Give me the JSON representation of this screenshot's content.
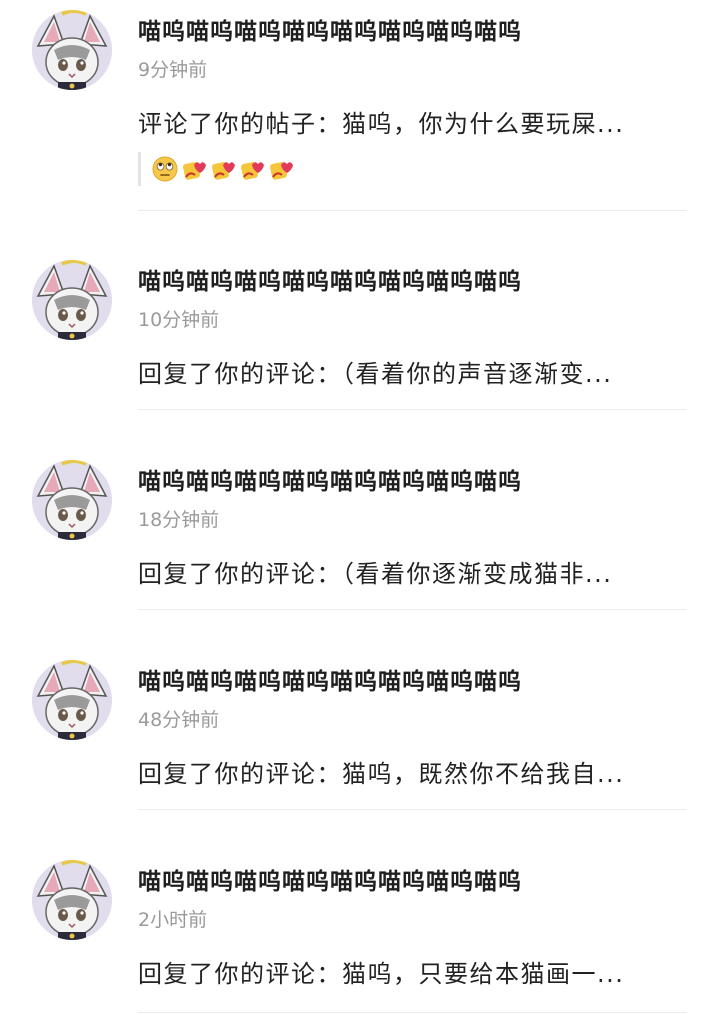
{
  "notifications": [
    {
      "username": "喵呜喵呜喵呜喵呜喵呜喵呜喵呜喵呜",
      "time": "9分钟前",
      "content": "评论了你的帖子：猫呜，你为什么要玩屎...",
      "quote_emojis": [
        "eye-roll-emoji",
        "pig-kiss-emoji",
        "pig-kiss-emoji",
        "pig-kiss-emoji",
        "pig-kiss-emoji"
      ]
    },
    {
      "username": "喵呜喵呜喵呜喵呜喵呜喵呜喵呜喵呜",
      "time": "10分钟前",
      "content": "回复了你的评论：（看着你的声音逐渐变..."
    },
    {
      "username": "喵呜喵呜喵呜喵呜喵呜喵呜喵呜喵呜",
      "time": "18分钟前",
      "content": "回复了你的评论：（看着你逐渐变成猫非..."
    },
    {
      "username": "喵呜喵呜喵呜喵呜喵呜喵呜喵呜喵呜",
      "time": "48分钟前",
      "content": "回复了你的评论：猫呜，既然你不给我自..."
    },
    {
      "username": "喵呜喵呜喵呜喵呜喵呜喵呜喵呜喵呜",
      "time": "2小时前",
      "content": "回复了你的评论：猫呜，只要给本猫画一..."
    }
  ],
  "colors": {
    "name_text": "#1f1f1f",
    "time_text": "#9a9a9a",
    "divider": "#ececec"
  }
}
